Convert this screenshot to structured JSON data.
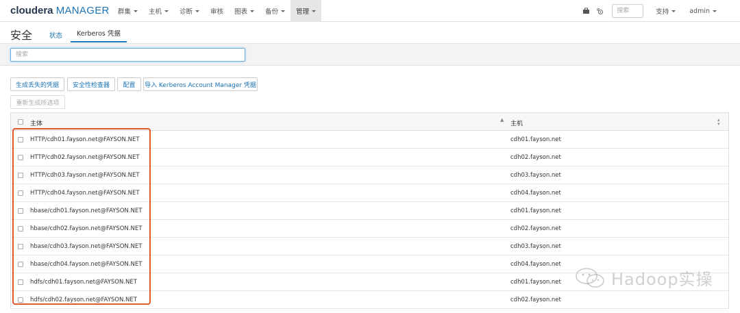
{
  "app": {
    "logo_brand": "cloudera",
    "logo_product": "MANAGER"
  },
  "nav": {
    "items": [
      {
        "label": "群集",
        "dropdown": true
      },
      {
        "label": "主机",
        "dropdown": true
      },
      {
        "label": "诊断",
        "dropdown": true
      },
      {
        "label": "审核",
        "dropdown": false
      },
      {
        "label": "图表",
        "dropdown": true
      },
      {
        "label": "备份",
        "dropdown": true
      },
      {
        "label": "管理",
        "dropdown": true,
        "active": true
      }
    ],
    "search_placeholder": "搜索",
    "support_label": "支持",
    "user_label": "admin",
    "icons": [
      "briefcase-icon",
      "running-commands-icon"
    ]
  },
  "page": {
    "title": "安全",
    "tabs": [
      {
        "label": "状态",
        "active": false
      },
      {
        "label": "Kerberos 凭据",
        "active": true
      }
    ]
  },
  "filter": {
    "search_placeholder": "搜索"
  },
  "actions": {
    "generate_missing": "生成丢失的凭据",
    "security_inspector": "安全性检查器",
    "configure": "配置",
    "import_kerberos": "导入 Kerberos Account Manager 凭据",
    "regenerate_selected": "重新生成所选项"
  },
  "table": {
    "headers": {
      "principal": "主体",
      "host": "主机"
    },
    "rows": [
      {
        "principal": "HTTP/cdh01.fayson.net@FAYSON.NET",
        "host": "cdh01.fayson.net"
      },
      {
        "principal": "HTTP/cdh02.fayson.net@FAYSON.NET",
        "host": "cdh02.fayson.net"
      },
      {
        "principal": "HTTP/cdh03.fayson.net@FAYSON.NET",
        "host": "cdh03.fayson.net"
      },
      {
        "principal": "HTTP/cdh04.fayson.net@FAYSON.NET",
        "host": "cdh04.fayson.net"
      },
      {
        "principal": "hbase/cdh01.fayson.net@FAYSON.NET",
        "host": "cdh01.fayson.net"
      },
      {
        "principal": "hbase/cdh02.fayson.net@FAYSON.NET",
        "host": "cdh02.fayson.net"
      },
      {
        "principal": "hbase/cdh03.fayson.net@FAYSON.NET",
        "host": "cdh03.fayson.net"
      },
      {
        "principal": "hbase/cdh04.fayson.net@FAYSON.NET",
        "host": "cdh04.fayson.net"
      },
      {
        "principal": "hdfs/cdh01.fayson.net@FAYSON.NET",
        "host": "cdh01.fayson.net"
      },
      {
        "principal": "hdfs/cdh02.fayson.net@FAYSON.NET",
        "host": "cdh02.fayson.net"
      }
    ]
  },
  "watermark": {
    "text": "Hadoop实操"
  },
  "colors": {
    "accent": "#1b74b7",
    "brand_dark": "#25364e",
    "highlight_border": "#e05a2b"
  }
}
